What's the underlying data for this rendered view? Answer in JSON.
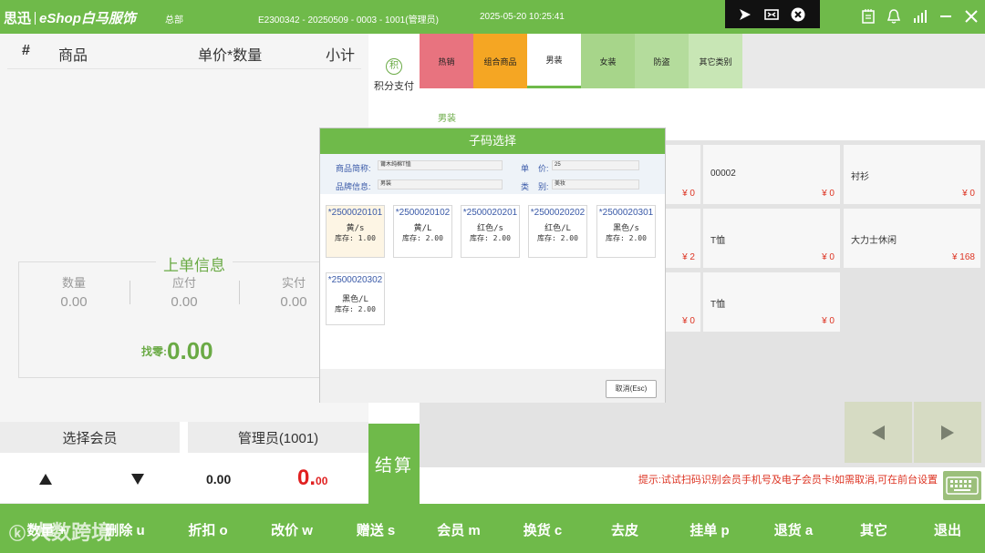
{
  "topbar": {
    "brand": "思迅",
    "product": "eShop白马服饰",
    "store": "总部",
    "session": "E2300342 - 20250509 - 0003 - 1001(管理员)",
    "datetime": "2025-05-20 10:25:41"
  },
  "cart": {
    "col_index": "#",
    "col_product": "商品",
    "col_price_qty": "单价*数量",
    "col_subtotal": "小计"
  },
  "order_info": {
    "title": "上单信息",
    "qty_label": "数量",
    "qty_value": "0.00",
    "due_label": "应付",
    "due_value": "0.00",
    "paid_label": "实付",
    "paid_value": "0.00",
    "change_label": "找零:",
    "change_value": "0.00"
  },
  "member": {
    "select_label": "选择会员",
    "operator_label": "管理员(1001)"
  },
  "totals": {
    "qty": "0.00",
    "amount_main": "0.",
    "amount_decimal": "00"
  },
  "side": {
    "points_pay": "积分支付",
    "points_icon_char": "积",
    "settle": "结算"
  },
  "tabs": [
    {
      "label": "热销",
      "color": "#e8737f"
    },
    {
      "label": "组合商品",
      "color": "#f5a623"
    },
    {
      "label": "男装",
      "color": "#ffffff"
    },
    {
      "label": "女装",
      "color": "#a7d58a"
    },
    {
      "label": "防盗",
      "color": "#b4dc9c"
    },
    {
      "label": "其它类别",
      "color": "#c8e6b5"
    }
  ],
  "active_category": "男装",
  "products": [
    {
      "name": "",
      "price": "¥ 0"
    },
    {
      "name": "00002",
      "price": "¥ 0"
    },
    {
      "name": "衬衫",
      "price": "¥ 0"
    },
    {
      "name": "",
      "price": "¥ 2"
    },
    {
      "name": "T恤",
      "price": "¥ 0"
    },
    {
      "name": "大力士休闲",
      "price": "¥ 168"
    },
    {
      "name": "",
      "price": "¥ 0"
    },
    {
      "name": "T恤",
      "price": "¥ 0"
    }
  ],
  "hint": "提示:试试扫码识别会员手机号及电子会员卡!如需取消,可在前台设置",
  "bottom_buttons": [
    "数量 +",
    "删除 u",
    "折扣 o",
    "改价 w",
    "赠送 s",
    "会员 m",
    "换货 c",
    "去皮",
    "挂单 p",
    "退货 a",
    "其它",
    "退出"
  ],
  "watermark": "大数跨境",
  "modal": {
    "title": "子码选择",
    "name_label": "商品简称:",
    "name_value": "莆木纯棉T恤",
    "price_label": "单    价:",
    "price_value": "25",
    "brand_label": "品牌信息:",
    "brand_value": "男装",
    "category_label": "类    别:",
    "category_value": "美妆",
    "skus": [
      {
        "code": "*2500020101",
        "attr": "黄/s",
        "stock": "库存: 1.00"
      },
      {
        "code": "*2500020102",
        "attr": "黄/L",
        "stock": "库存: 2.00"
      },
      {
        "code": "*2500020201",
        "attr": "红色/s",
        "stock": "库存: 2.00"
      },
      {
        "code": "*2500020202",
        "attr": "红色/L",
        "stock": "库存: 2.00"
      },
      {
        "code": "*2500020301",
        "attr": "黑色/s",
        "stock": "库存: 2.00"
      },
      {
        "code": "*2500020302",
        "attr": "黑色/L",
        "stock": "库存: 2.00"
      }
    ],
    "cancel": "取消(Esc)"
  },
  "colors": {
    "brand_green": "#6fba4a",
    "alert_red": "#dd3322",
    "link_blue": "#3a5aa8"
  }
}
